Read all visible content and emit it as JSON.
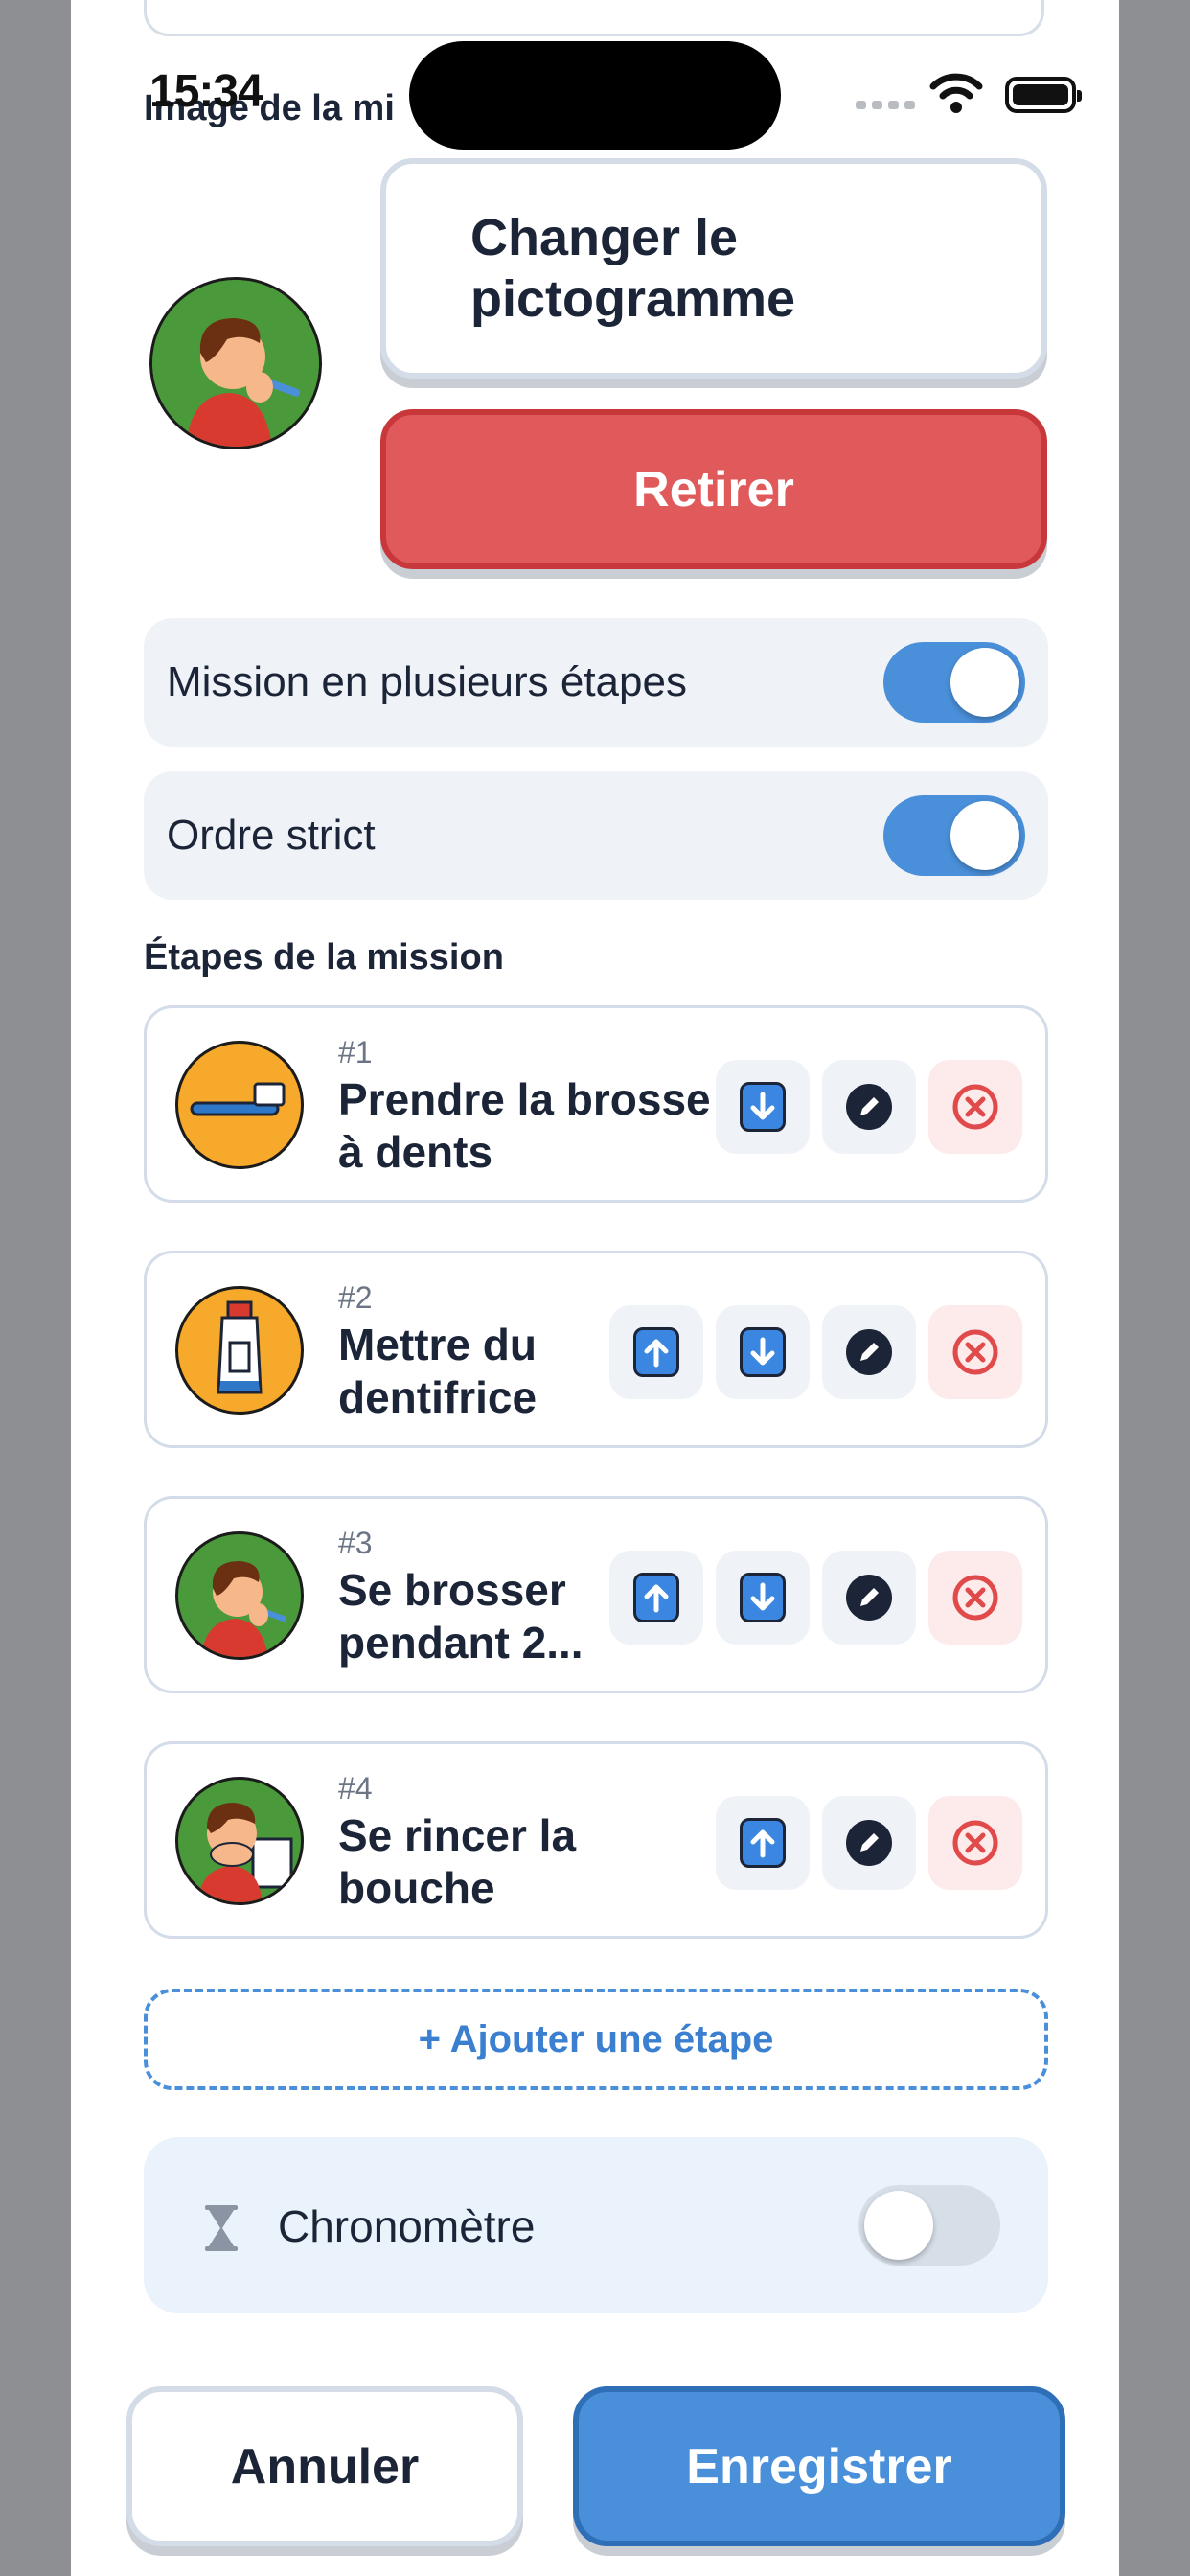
{
  "status_bar": {
    "time": "15:34"
  },
  "form": {
    "image_section_label": "Image de la mi",
    "change_picto_label": "Changer le pictogramme",
    "remove_label": "Retirer",
    "multi_step_label": "Mission en plusieurs étapes",
    "multi_step_on": true,
    "strict_order_label": "Ordre strict",
    "strict_order_on": true,
    "steps_title": "Étapes de la mission",
    "steps": [
      {
        "number": "#1",
        "title": "Prendre la brosse à dents",
        "icon": "toothbrush-icon",
        "can_move_up": false,
        "can_move_down": true
      },
      {
        "number": "#2",
        "title": "Mettre du dentifrice",
        "icon": "toothpaste-icon",
        "can_move_up": true,
        "can_move_down": true
      },
      {
        "number": "#3",
        "title": "Se brosser pendant 2...",
        "icon": "boy-brushing-teeth-icon",
        "can_move_up": true,
        "can_move_down": true
      },
      {
        "number": "#4",
        "title": "Se rincer la bouche",
        "icon": "boy-rinsing-mouth-icon",
        "can_move_up": true,
        "can_move_down": false
      }
    ],
    "add_step_label": "+ Ajouter une étape",
    "timer_label": "Chronomètre",
    "timer_on": false
  },
  "footer": {
    "cancel_label": "Annuler",
    "save_label": "Enregistrer"
  },
  "colors": {
    "accent": "#4a8fd9",
    "danger": "#e05a5c",
    "text": "#1b2537"
  }
}
